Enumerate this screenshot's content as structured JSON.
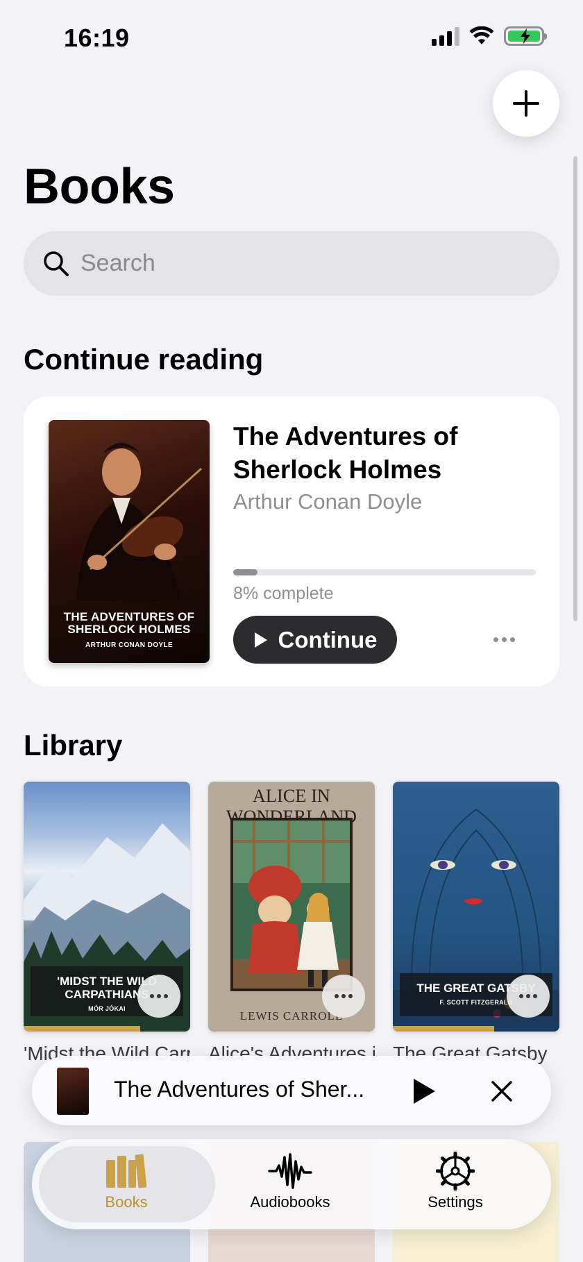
{
  "status_bar": {
    "time": "16:19"
  },
  "header": {
    "title": "Books"
  },
  "search": {
    "placeholder": "Search"
  },
  "continue_reading": {
    "heading": "Continue reading",
    "book": {
      "title": "The Adventures of Sherlock Holmes",
      "author": "Arthur Conan Doyle",
      "cover_title": "THE ADVENTURES OF SHERLOCK HOLMES",
      "cover_author": "ARTHUR CONAN DOYLE",
      "progress": 0.08,
      "progress_label": "8% complete",
      "continue_label": "Continue"
    }
  },
  "library": {
    "heading": "Library",
    "books": [
      {
        "caption": "'Midst the Wild Carpathians",
        "cover_title": "'MIDST THE WILD CARPATHIANS",
        "cover_author": "MÓR JÓKAI",
        "read_progress": 0.7
      },
      {
        "caption": "Alice's Adventures in Wonderland",
        "cover_title": "ALICE IN WONDERLAND",
        "cover_author": "LEWIS CARROLL",
        "read_progress": 0
      },
      {
        "caption": "The Great Gatsby",
        "cover_title": "THE GREAT GATSBY",
        "cover_author": "F. SCOTT FITZGERALD",
        "read_progress": 0.61
      }
    ]
  },
  "mini_player": {
    "title": "The Adventures of Sher..."
  },
  "tabs": [
    {
      "label": "Books",
      "active": true,
      "icon": "books-icon"
    },
    {
      "label": "Audiobooks",
      "active": false,
      "icon": "waveform-icon"
    },
    {
      "label": "Settings",
      "active": false,
      "icon": "gear-icon"
    }
  ],
  "colors": {
    "accent": "#b8912d",
    "progress_track": "#e5e5ea",
    "button_dark": "#2c2c2e"
  }
}
